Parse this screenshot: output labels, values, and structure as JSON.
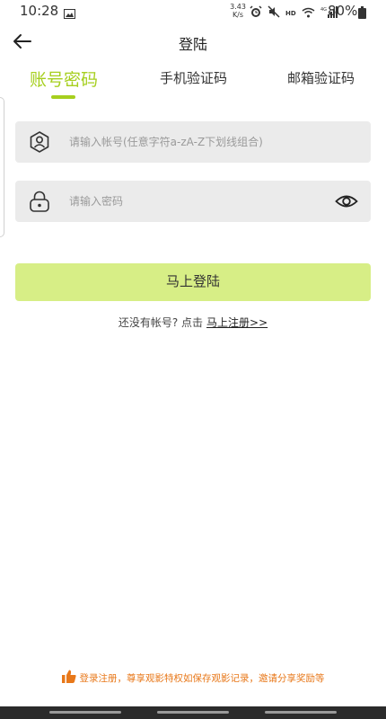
{
  "status_bar": {
    "time": "10:28",
    "speed_value": "3.43",
    "speed_unit": "K/s",
    "hd": "HD",
    "network": "4G",
    "battery": "80%"
  },
  "header": {
    "title": "登陆"
  },
  "tabs": [
    {
      "label": "账号密码",
      "active": true
    },
    {
      "label": "手机验证码",
      "active": false
    },
    {
      "label": "邮箱验证码",
      "active": false
    }
  ],
  "form": {
    "account_placeholder": "请输入帐号(任意字符a-zA-Z下划线组合)",
    "password_placeholder": "请输入密码",
    "login_label": "马上登陆"
  },
  "register": {
    "prompt": "还没有帐号? 点击",
    "link": "马上注册>>"
  },
  "footer": {
    "note": "登录注册，尊享观影特权如保存观影记录，邀请分享奖励等"
  },
  "colors": {
    "accent": "#a6cf1e",
    "button_bg": "#d7ee86",
    "field_bg": "#ebebeb",
    "footer_text": "#e8781a"
  }
}
